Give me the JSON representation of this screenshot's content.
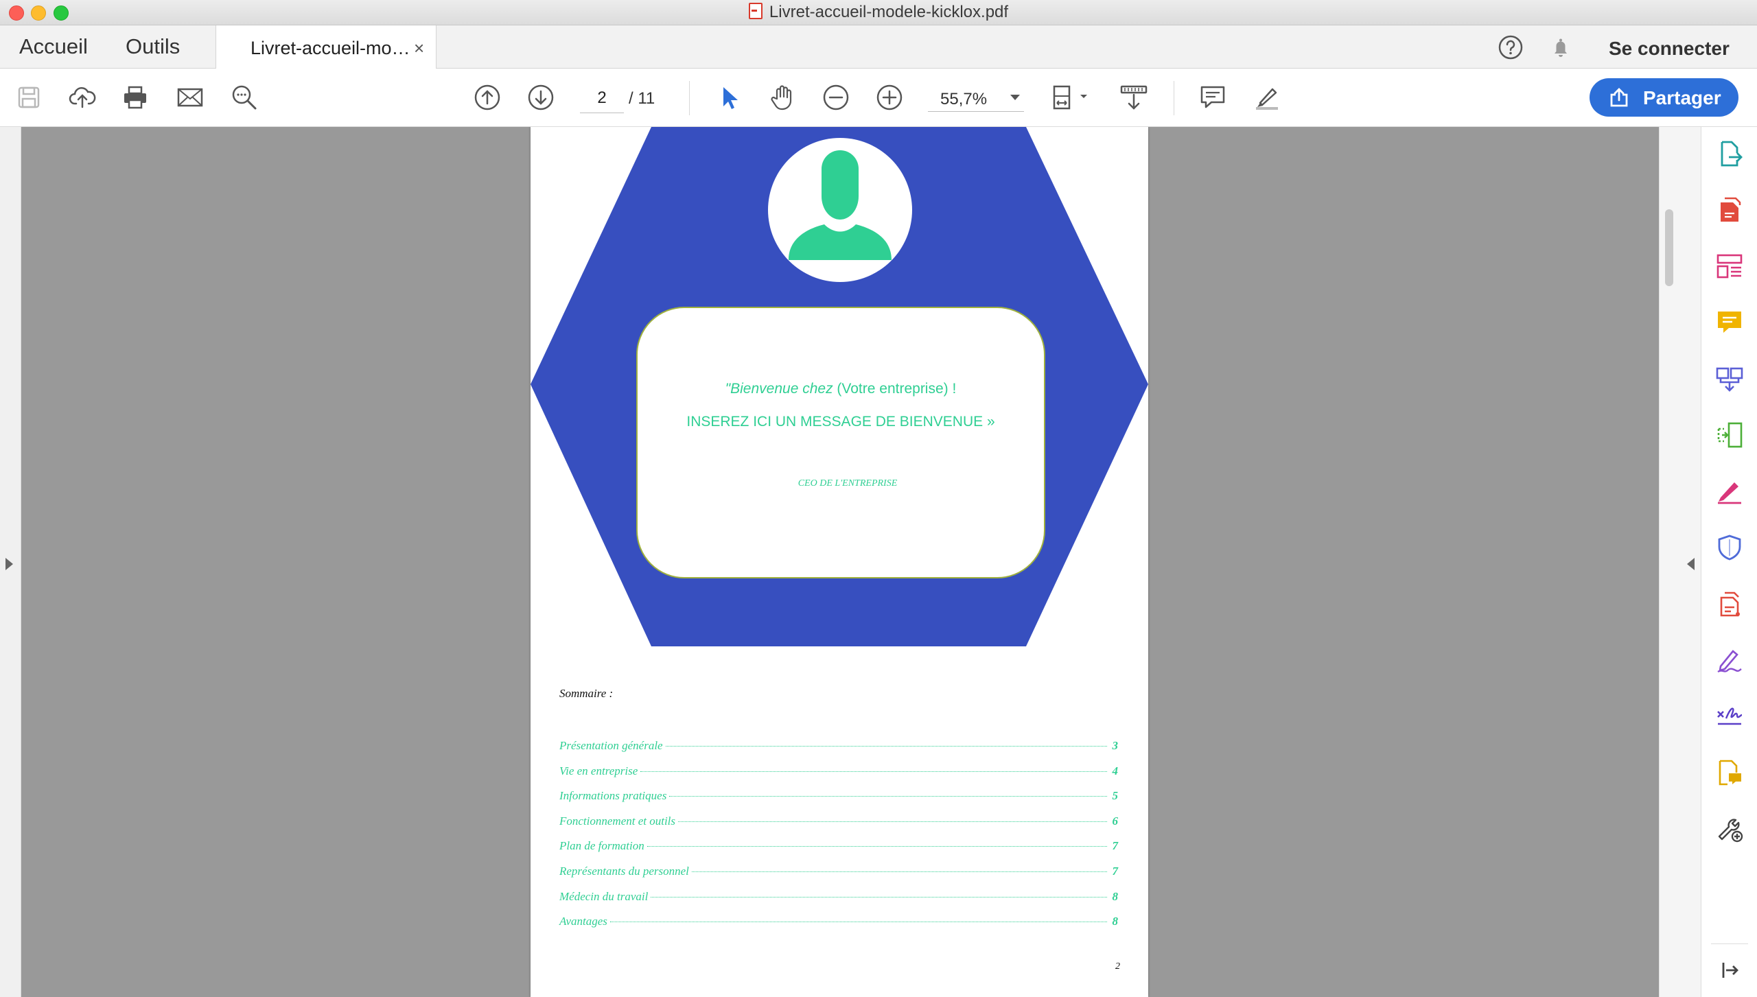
{
  "window": {
    "title": "Livret-accueil-modele-kicklox.pdf"
  },
  "tabs": {
    "home": "Accueil",
    "tools": "Outils",
    "document_tab": "Livret-accueil-mo…",
    "close_glyph": "×"
  },
  "header": {
    "sign_in": "Se connecter"
  },
  "toolbar": {
    "current_page": "2",
    "page_total": "/ 11",
    "zoom": "55,7%",
    "share_label": "Partager"
  },
  "document": {
    "welcome_line1_italic": "\"Bienvenue chez",
    "welcome_line1_rest": " (Votre entreprise) !",
    "welcome_line2": "INSEREZ ICI UN MESSAGE DE BIENVENUE »",
    "welcome_signature": "CEO DE L'ENTREPRISE",
    "toc_title": "Sommaire :",
    "toc": [
      {
        "label": "Présentation générale",
        "page": "3"
      },
      {
        "label": "Vie en entreprise",
        "page": "4"
      },
      {
        "label": "Informations pratiques",
        "page": "5"
      },
      {
        "label": "Fonctionnement et outils",
        "page": "6"
      },
      {
        "label": "Plan de formation",
        "page": "7"
      },
      {
        "label": "Représentants du personnel",
        "page": "7"
      },
      {
        "label": "Médecin du travail",
        "page": "8"
      },
      {
        "label": "Avantages",
        "page": "8"
      }
    ],
    "page_number": "2"
  },
  "colors": {
    "hexagon": "#374fbf",
    "accent_green": "#2fcf93",
    "share_button": "#2d6fd8",
    "card_border": "#9fb13e"
  },
  "icons": {
    "toolbar": [
      "save-icon",
      "cloud-upload-icon",
      "print-icon",
      "mail-icon",
      "search-icon",
      "page-up-icon",
      "page-down-icon",
      "select-arrow-icon",
      "hand-icon",
      "zoom-out-icon",
      "zoom-in-icon",
      "fit-page-icon",
      "scroll-mode-icon",
      "comment-icon",
      "highlight-pen-icon"
    ],
    "right_rail": [
      "export-pdf-icon",
      "create-pdf-icon",
      "organize-pages-icon",
      "comment-tool-icon",
      "combine-files-icon",
      "compress-pdf-icon",
      "fill-sign-icon",
      "protect-icon",
      "pdf-edit-icon",
      "sign-icon",
      "signature-request-icon",
      "send-for-comments-icon",
      "more-tools-icon",
      "collapse-panel-icon"
    ]
  }
}
